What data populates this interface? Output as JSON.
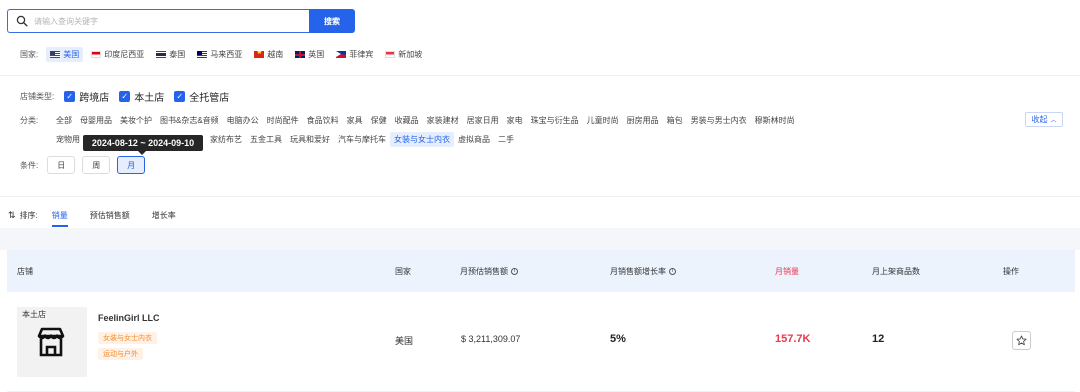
{
  "search": {
    "placeholder": "请输入查询关键字",
    "button_label": "搜索"
  },
  "country": {
    "label": "国家:",
    "items": [
      {
        "label": "美国",
        "flag": "us-flag-icon",
        "active": true
      },
      {
        "label": "印度尼西亚",
        "flag": "indonesia-flag-icon"
      },
      {
        "label": "泰国",
        "flag": "thailand-flag-icon"
      },
      {
        "label": "马来西亚",
        "flag": "malaysia-flag-icon"
      },
      {
        "label": "越南",
        "flag": "vietnam-flag-icon"
      },
      {
        "label": "英国",
        "flag": "uk-flag-icon"
      },
      {
        "label": "菲律宾",
        "flag": "philippines-flag-icon"
      },
      {
        "label": "新加坡",
        "flag": "singapore-flag-icon"
      }
    ]
  },
  "store_type": {
    "label": "店铺类型:",
    "options": [
      {
        "label": "跨境店",
        "checked": true
      },
      {
        "label": "本土店",
        "checked": true
      },
      {
        "label": "全托管店",
        "checked": true
      }
    ]
  },
  "category": {
    "label": "分类:",
    "row1": [
      "全部",
      "母婴用品",
      "美妆个护",
      "图书&杂志&音频",
      "电脑办公",
      "时尚配件",
      "食品饮料",
      "家具",
      "保健",
      "收藏品",
      "家装建材",
      "居家日用",
      "家电",
      "珠宝与衍生品",
      "儿童时尚",
      "厨房用品",
      "箱包",
      "男装与男士内衣",
      "穆斯林时尚"
    ],
    "row2": [
      "宠物用",
      "动与户外",
      "家纺布艺",
      "五金工具",
      "玩具和爱好",
      "汽车与摩托车",
      "女装与女士内衣",
      "虚拟商品",
      "二手"
    ],
    "active": "女装与女士内衣",
    "collapse_label": "收起"
  },
  "tooltip": {
    "text": "2024-08-12 ~ 2024-09-10"
  },
  "condition": {
    "label": "条件:",
    "options": [
      "日",
      "周",
      "月"
    ],
    "active": "月"
  },
  "sort": {
    "label": "排序:",
    "tabs": [
      "销量",
      "预估销售额",
      "增长率"
    ],
    "active": "销量"
  },
  "table": {
    "headers": {
      "store": "店铺",
      "country": "国家",
      "monthly_est_sales": "月预估销售额",
      "monthly_growth": "月销售额增长率",
      "monthly_volume": "月销量",
      "monthly_new_products": "月上架商品数",
      "actions": "操作"
    },
    "rows": [
      {
        "store_tag": "本土店",
        "store_name": "FeelinGirl LLC",
        "badges": [
          "女装与女士内衣",
          "运动与户外"
        ],
        "country": "美国",
        "monthly_est_sales": "$ 3,211,309.07",
        "monthly_growth": "5%",
        "monthly_volume": "157.7K",
        "monthly_new_products": "12"
      }
    ]
  },
  "colors": {
    "accent": "#2563eb",
    "highlight_red": "#e8384f",
    "badge_orange": "#f28c28"
  }
}
